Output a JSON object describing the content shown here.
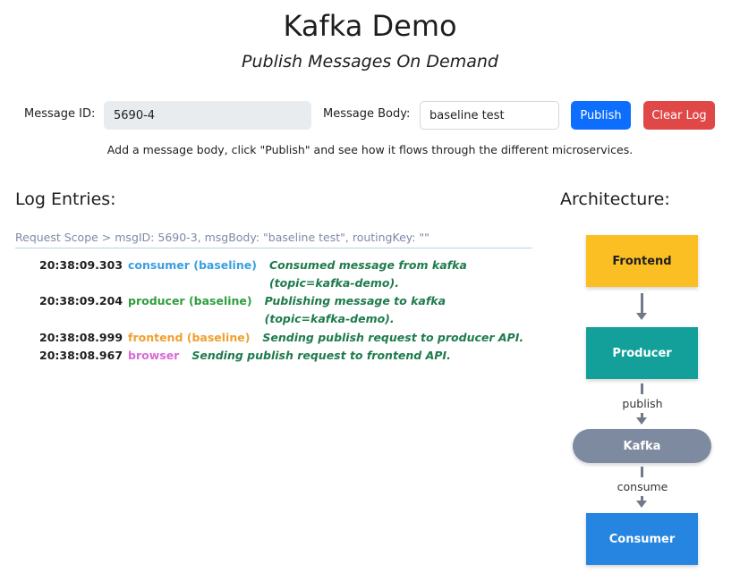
{
  "header": {
    "title": "Kafka Demo",
    "subtitle": "Publish Messages On Demand"
  },
  "form": {
    "message_id_label": "Message ID:",
    "message_id_value": "5690-4",
    "message_body_label": "Message Body:",
    "message_body_value": "baseline test",
    "publish_label": "Publish",
    "clear_label": "Clear Log",
    "hint": "Add a message body, click \"Publish\" and see how it flows through the different microservices."
  },
  "log": {
    "heading": "Log Entries:",
    "scope": "Request Scope > msgID: 5690-3, msgBody: \"baseline test\", routingKey: \"\"",
    "entries": [
      {
        "time": "20:38:09.303",
        "service": "consumer (baseline)",
        "message": "Consumed message from kafka (topic=kafka-demo)."
      },
      {
        "time": "20:38:09.204",
        "service": "producer (baseline)",
        "message": "Publishing message to kafka (topic=kafka-demo)."
      },
      {
        "time": "20:38:08.999",
        "service": "frontend (baseline)",
        "message": "Sending publish request to producer API."
      },
      {
        "time": "20:38:08.967",
        "service": "browser",
        "message": "Sending publish request to frontend API."
      }
    ]
  },
  "architecture": {
    "heading": "Architecture:",
    "frontend": "Frontend",
    "producer": "Producer",
    "kafka": "Kafka",
    "consumer": "Consumer",
    "publish_label": "publish",
    "consume_label": "consume"
  },
  "colors": {
    "publish_button": "#0d6efd",
    "clear_button": "#e04848",
    "consumer_service": "#3aa0e0",
    "producer_service": "#2e9e3e",
    "frontend_service": "#f0a030",
    "browser_service": "#d86ad8",
    "log_message": "#1e7b4c",
    "frontend_box": "#fbbf24",
    "producer_box": "#14a09a",
    "kafka_box": "#7d8aa0",
    "consumer_box": "#2585e0"
  }
}
